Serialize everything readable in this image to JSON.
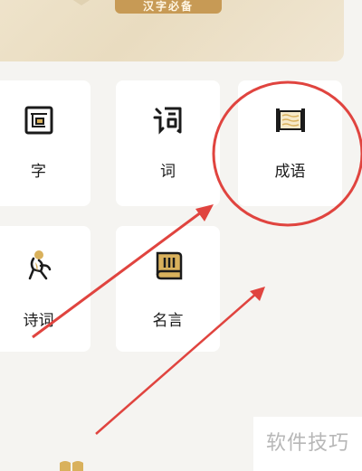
{
  "banner": {
    "button_label": "汉字必备"
  },
  "tiles": [
    {
      "label": "字",
      "icon": "character-box-icon"
    },
    {
      "label": "词",
      "icon": "word-glyph-icon"
    },
    {
      "label": "成语",
      "icon": "scroll-icon"
    },
    {
      "label": "诗词",
      "icon": "poet-figure-icon"
    },
    {
      "label": "名言",
      "icon": "book-scroll-icon"
    }
  ],
  "watermark": "软件技巧",
  "colors": {
    "accent": "#c79a55",
    "annotation": "#e0443f",
    "icon_dark": "#1b1b1b",
    "icon_gold": "#d9b15c"
  }
}
